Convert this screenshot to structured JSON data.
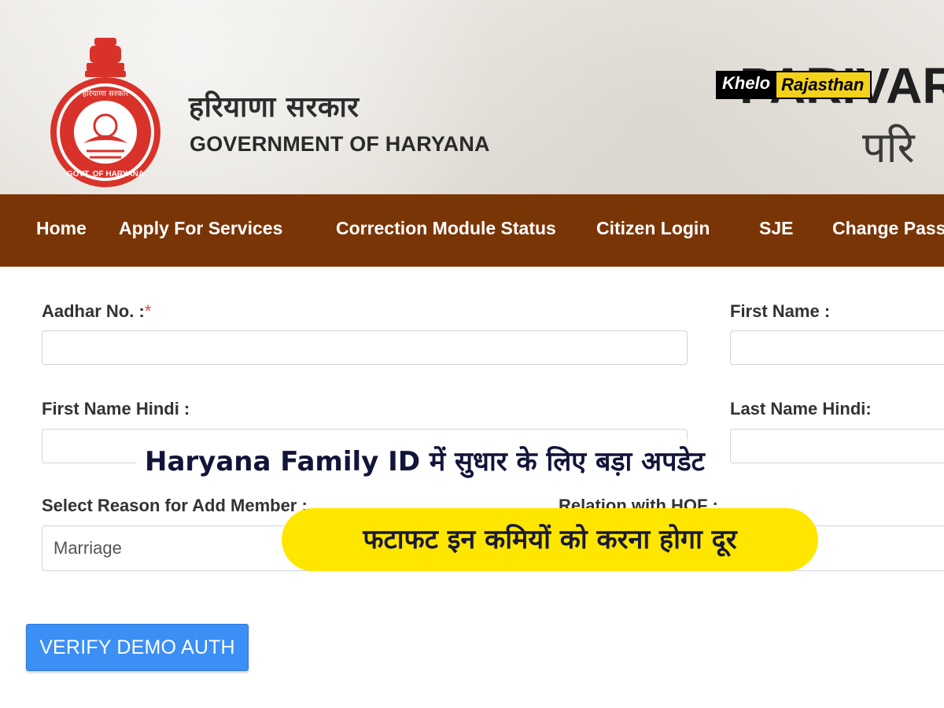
{
  "header": {
    "gov_hindi": "हरियाणा सरकार",
    "gov_english": "GOVERNMENT OF HARYANA",
    "brand_title": "PARIVAR",
    "brand_sub": "परि",
    "watermark": {
      "part1": "Khelo",
      "part2": "Rajasthan"
    }
  },
  "nav": {
    "items": [
      {
        "label": "Home"
      },
      {
        "label": "Apply For Services"
      },
      {
        "label": "Correction Module Status"
      },
      {
        "label": "Citizen Login"
      },
      {
        "label": "SJE"
      },
      {
        "label": "Change Pass"
      }
    ]
  },
  "form": {
    "aadhar_label": "Aadhar No. :",
    "aadhar_required": "*",
    "aadhar_value": "",
    "first_name_label": "First Name :",
    "first_name_value": "",
    "first_name_hindi_label": "First Name Hindi :",
    "first_name_hindi_value": "",
    "last_name_hindi_label": "Last Name Hindi:",
    "last_name_hindi_value": "",
    "reason_label": "Select Reason for Add Member :",
    "reason_value": "Marriage",
    "relation_label": "Relation with HOF :",
    "verify_button": "VERIFY DEMO AUTH"
  },
  "overlay": {
    "headline": "Haryana Family ID में सुधार के लिए बड़ा अपडेट",
    "subheadline": "फटाफट इन कमियों को करना होगा दूर"
  },
  "colors": {
    "nav_background": "#7a3507",
    "button": "#3b8ff5",
    "highlight": "#ffe600",
    "emblem_red": "#d9322a"
  }
}
